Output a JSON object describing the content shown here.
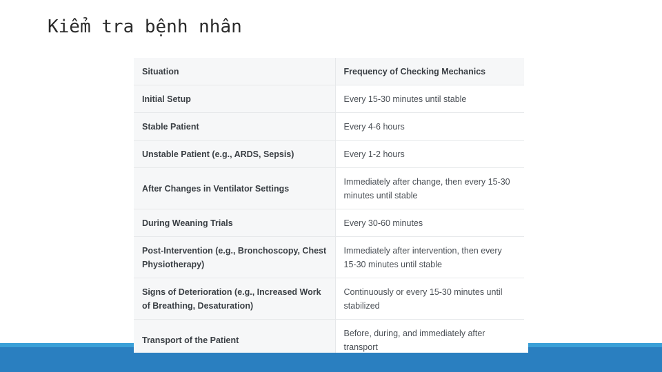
{
  "slide": {
    "title": "Kiểm tra bệnh nhân"
  },
  "table": {
    "headers": [
      "Situation",
      "Frequency of Checking Mechanics"
    ],
    "rows": [
      [
        "Initial Setup",
        "Every 15-30 minutes until stable"
      ],
      [
        "Stable Patient",
        "Every 4-6 hours"
      ],
      [
        "Unstable Patient (e.g., ARDS, Sepsis)",
        "Every 1-2 hours"
      ],
      [
        "After Changes in Ventilator Settings",
        "Immediately after change, then every 15-30 minutes until stable"
      ],
      [
        "During Weaning Trials",
        "Every 30-60 minutes"
      ],
      [
        "Post-Intervention (e.g., Bronchoscopy, Chest Physiotherapy)",
        "Immediately after intervention, then every 15-30 minutes until stable"
      ],
      [
        "Signs of Deterioration (e.g., Increased Work of Breathing, Desaturation)",
        "Continuously or every 15-30 minutes until stabilized"
      ],
      [
        "Transport of the Patient",
        "Before, during, and immediately after transport"
      ]
    ]
  },
  "colors": {
    "bottom_bar": "#2a7fc0",
    "bottom_stripe": "#3aa0d8"
  }
}
